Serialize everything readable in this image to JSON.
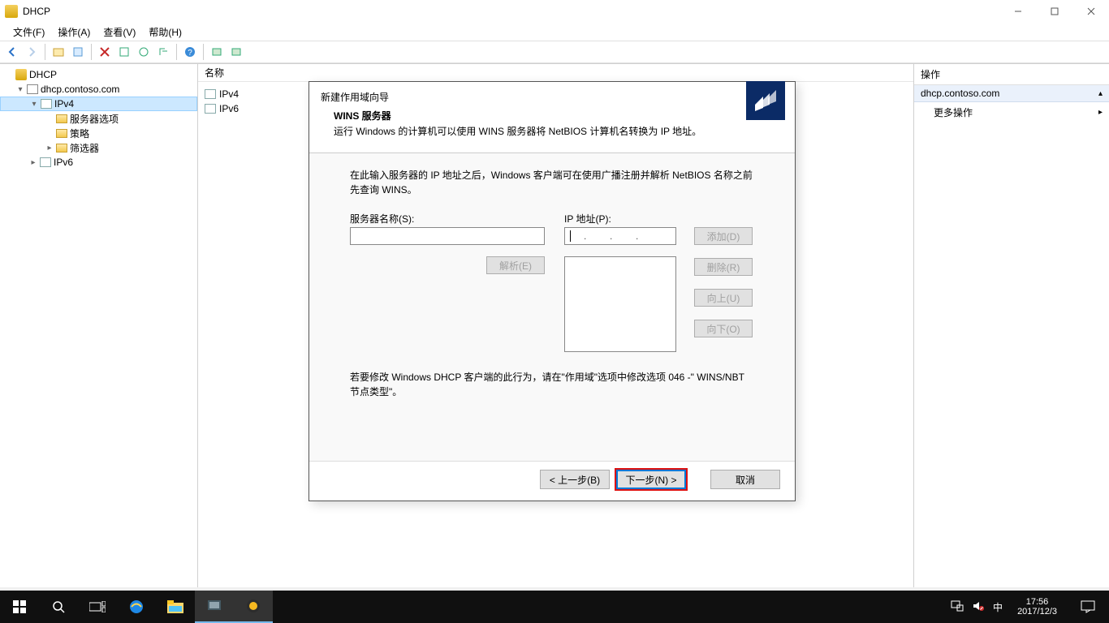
{
  "window": {
    "title": "DHCP"
  },
  "menu": {
    "file": "文件(F)",
    "action": "操作(A)",
    "view": "查看(V)",
    "help": "帮助(H)"
  },
  "tree": {
    "root": "DHCP",
    "server": "dhcp.contoso.com",
    "ipv4": "IPv4",
    "server_options": "服务器选项",
    "policies": "策略",
    "filters": "筛选器",
    "ipv6": "IPv6"
  },
  "list": {
    "header": "名称",
    "items": [
      "IPv4",
      "IPv6"
    ]
  },
  "actions": {
    "title": "操作",
    "server": "dhcp.contoso.com",
    "more": "更多操作"
  },
  "wizard": {
    "title": "新建作用域向导",
    "section_title": "WINS 服务器",
    "section_desc": "运行 Windows 的计算机可以使用 WINS 服务器将 NetBIOS 计算机名转换为 IP 地址。",
    "body_desc": "在此输入服务器的 IP 地址之后，Windows 客户端可在使用广播注册并解析 NetBIOS 名称之前先查询 WINS。",
    "server_name_label": "服务器名称(S):",
    "ip_label": "IP 地址(P):",
    "ip_placeholder": ".       .       .",
    "btn_add": "添加(D)",
    "btn_resolve": "解析(E)",
    "btn_remove": "删除(R)",
    "btn_up": "向上(U)",
    "btn_down": "向下(O)",
    "note": "若要修改 Windows DHCP 客户端的此行为，请在\"作用域\"选项中修改选项 046 -\" WINS/NBT 节点类型\"。",
    "btn_back": "< 上一步(B)",
    "btn_next": "下一步(N) >",
    "btn_cancel": "取消"
  },
  "taskbar": {
    "time": "17:56",
    "date": "2017/12/3",
    "ime": "中"
  }
}
